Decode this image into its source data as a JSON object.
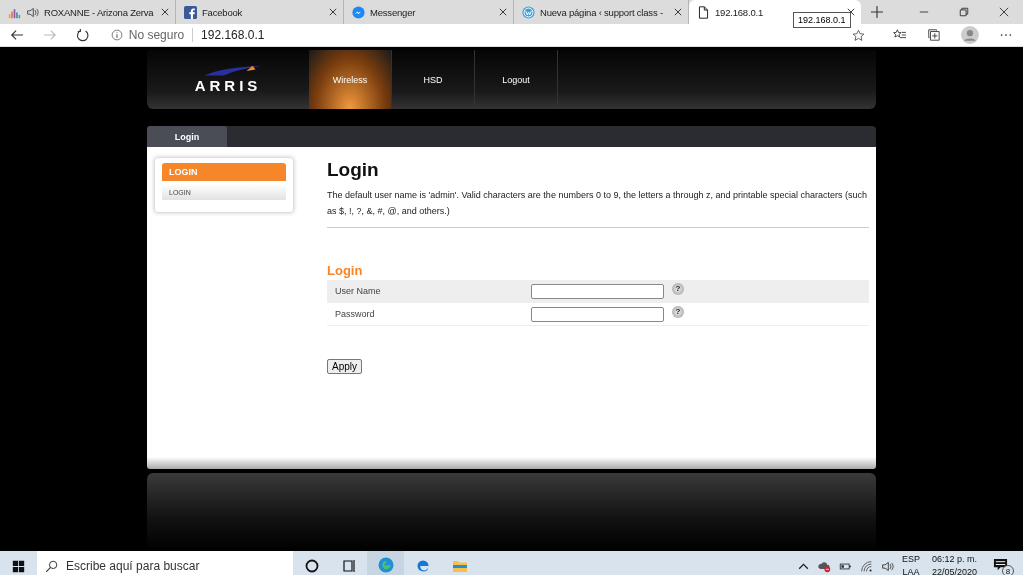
{
  "browser": {
    "tabs": [
      {
        "title": "ROXANNE - Arizona Zerva",
        "kind": "music",
        "audio": true,
        "selected": false
      },
      {
        "title": "Facebook",
        "kind": "facebook",
        "audio": false,
        "selected": false
      },
      {
        "title": "Messenger",
        "kind": "messenger",
        "audio": false,
        "selected": false
      },
      {
        "title": "Nueva página ‹ support class -",
        "kind": "wordpress",
        "audio": false,
        "selected": false
      },
      {
        "title": "192.168.0.1",
        "kind": "page",
        "audio": false,
        "selected": true
      }
    ],
    "tooltip": "192.168.0.1",
    "address": {
      "security": "No seguro",
      "url": "192.168.0.1"
    }
  },
  "header": {
    "logo": "ARRIS",
    "nav": [
      {
        "label": "Wireless",
        "selected": true
      },
      {
        "label": "HSD",
        "selected": false
      },
      {
        "label": "Logout",
        "selected": false
      }
    ]
  },
  "page_tab": "Login",
  "sidebar": {
    "items": [
      {
        "label": "LOGIN",
        "selected": true
      },
      {
        "label": "LOGIN",
        "selected": false
      }
    ]
  },
  "title": "Login",
  "description": "The default user name is 'admin'. Valid characters are the numbers 0 to 9, the letters a through z, and printable special characters (such as $, !, ?, &, #, @, and others.)",
  "form": {
    "heading": "Login",
    "fields": [
      {
        "label": "User Name",
        "help": "?"
      },
      {
        "label": "Password",
        "help": "?"
      }
    ],
    "button": "Apply"
  },
  "taskbar": {
    "search_placeholder": "Escribe aquí para buscar",
    "apps": [
      {
        "kind": "cortana",
        "active": false
      },
      {
        "kind": "taskview",
        "active": false
      },
      {
        "kind": "edge-new",
        "active": true
      },
      {
        "kind": "edge",
        "active": false
      },
      {
        "kind": "explorer",
        "active": false
      }
    ],
    "language": "ESP",
    "layout": "LAA",
    "time": "06:12 p. m.",
    "date": "22/05/2020",
    "notifications": "8"
  }
}
